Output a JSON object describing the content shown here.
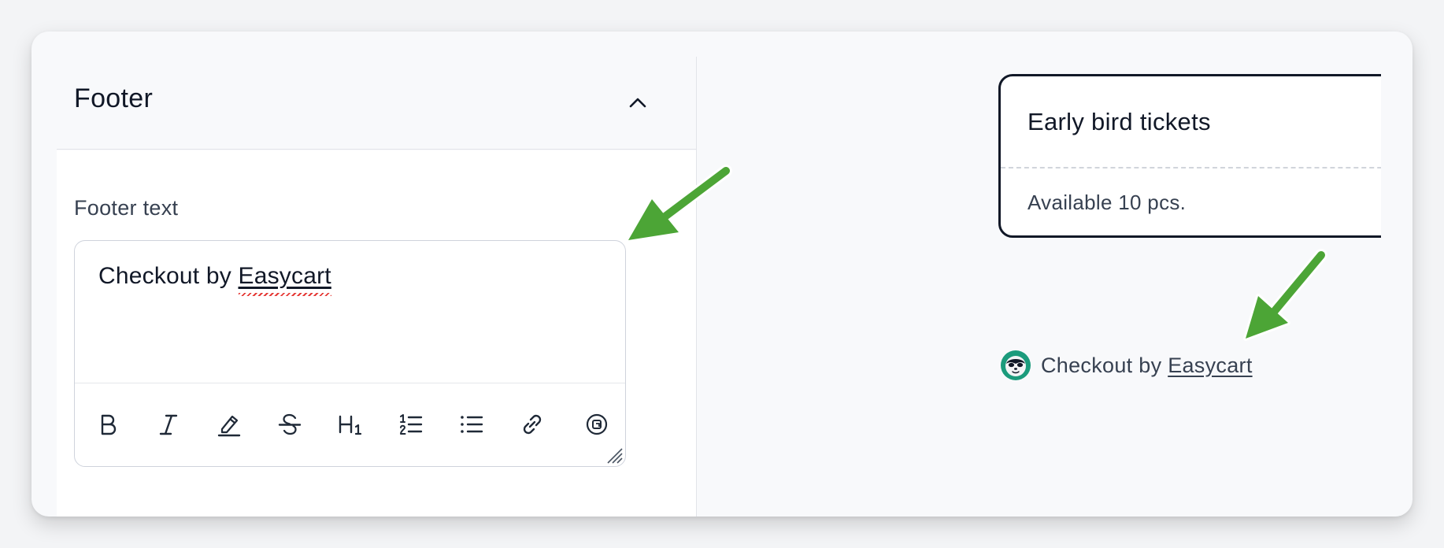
{
  "left_panel": {
    "title": "Footer",
    "field_label": "Footer text",
    "editor": {
      "text_prefix": "Checkout by ",
      "link_text": "Easycart"
    },
    "toolbar": {
      "items": [
        "bold-icon",
        "italic-icon",
        "highlight-icon",
        "strikethrough-icon",
        "heading-1-icon",
        "ordered-list-icon",
        "bullet-list-icon",
        "link-icon",
        "embed-icon"
      ]
    }
  },
  "preview": {
    "ticket": {
      "title": "Early bird tickets",
      "availability": "Available 10 pcs."
    },
    "footer": {
      "text_prefix": "Checkout by ",
      "link_text": "Easycart",
      "logo_icon": "sloth-logo-icon"
    }
  },
  "colors": {
    "arrow": "#4ca536",
    "logo_ring": "#1b9b7c",
    "text_primary": "#111827",
    "text_secondary": "#374151"
  }
}
